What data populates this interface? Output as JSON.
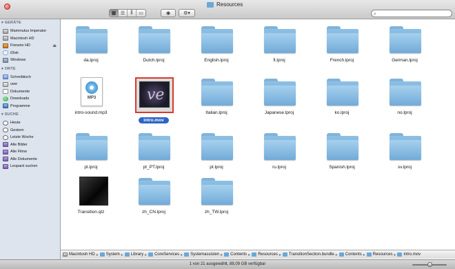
{
  "window": {
    "title": "Resources"
  },
  "search": {
    "placeholder": ""
  },
  "sidebar": {
    "sections": [
      {
        "title": "GERÄTE",
        "items": [
          {
            "label": "Mammutus Imperator",
            "icon": "hard-drive-icon"
          },
          {
            "label": "Macintosh HD",
            "icon": "hard-drive-icon"
          },
          {
            "label": "Firewire HD",
            "icon": "external-drive-icon",
            "eject": "⏏"
          },
          {
            "label": "iDisk",
            "icon": "idisk-icon"
          },
          {
            "label": "Windows",
            "icon": "network-volume-icon"
          }
        ]
      },
      {
        "title": "ORTE",
        "items": [
          {
            "label": "Schreibtisch",
            "icon": "desktop-icon"
          },
          {
            "label": "uwe",
            "icon": "home-icon"
          },
          {
            "label": "Dokumente",
            "icon": "documents-icon"
          },
          {
            "label": "Downloads",
            "icon": "downloads-icon"
          },
          {
            "label": "Programme",
            "icon": "applications-icon"
          }
        ]
      },
      {
        "title": "SUCHE",
        "items": [
          {
            "label": "Heute",
            "icon": "clock-icon"
          },
          {
            "label": "Gestern",
            "icon": "clock-icon"
          },
          {
            "label": "Letzte Woche",
            "icon": "clock-icon"
          },
          {
            "label": "Alle Bilder",
            "icon": "smart-folder-icon"
          },
          {
            "label": "Alle Filme",
            "icon": "smart-folder-icon"
          },
          {
            "label": "Alle Dokumente",
            "icon": "smart-folder-icon"
          },
          {
            "label": "Leopard suchen",
            "icon": "smart-folder-icon"
          }
        ]
      }
    ]
  },
  "files": [
    {
      "name": "da.lproj",
      "kind": "folder"
    },
    {
      "name": "Dutch.lproj",
      "kind": "folder"
    },
    {
      "name": "English.lproj",
      "kind": "folder"
    },
    {
      "name": "fi.lproj",
      "kind": "folder"
    },
    {
      "name": "French.lproj",
      "kind": "folder"
    },
    {
      "name": "German.lproj",
      "kind": "folder"
    },
    {
      "name": "intro-sound.mp3",
      "kind": "mp3",
      "badge": "MP3"
    },
    {
      "name": "intro.mov",
      "kind": "movie",
      "selected": true
    },
    {
      "name": "Italian.lproj",
      "kind": "folder"
    },
    {
      "name": "Japanese.lproj",
      "kind": "folder"
    },
    {
      "name": "ko.lproj",
      "kind": "folder"
    },
    {
      "name": "no.lproj",
      "kind": "folder"
    },
    {
      "name": "pl.lproj",
      "kind": "folder"
    },
    {
      "name": "pt_PT.lproj",
      "kind": "folder"
    },
    {
      "name": "pt.lproj",
      "kind": "folder"
    },
    {
      "name": "ru.lproj",
      "kind": "folder"
    },
    {
      "name": "Spanish.lproj",
      "kind": "folder"
    },
    {
      "name": "sv.lproj",
      "kind": "folder"
    },
    {
      "name": "Transition.qtz",
      "kind": "quartz"
    },
    {
      "name": "zh_CN.lproj",
      "kind": "folder"
    },
    {
      "name": "zh_TW.lproj",
      "kind": "folder"
    }
  ],
  "pathbar": [
    {
      "label": "Macintosh HD",
      "icon": "hard-drive-icon"
    },
    {
      "label": "System",
      "icon": "folder-icon"
    },
    {
      "label": "Library",
      "icon": "folder-icon"
    },
    {
      "label": "CoreServices",
      "icon": "folder-icon"
    },
    {
      "label": "Systemassisten",
      "icon": "app-icon"
    },
    {
      "label": "Contents",
      "icon": "folder-icon"
    },
    {
      "label": "Resources",
      "icon": "folder-icon"
    },
    {
      "label": "TransitionSection.bundle",
      "icon": "bundle-icon"
    },
    {
      "label": "Contents",
      "icon": "folder-icon"
    },
    {
      "label": "Resources",
      "icon": "folder-icon"
    },
    {
      "label": "intro.mov",
      "icon": "movie-icon"
    }
  ],
  "status": {
    "text": "1 von 21 ausgewählt, 88,09 GB verfügbar",
    "icon_size": 0.5
  }
}
